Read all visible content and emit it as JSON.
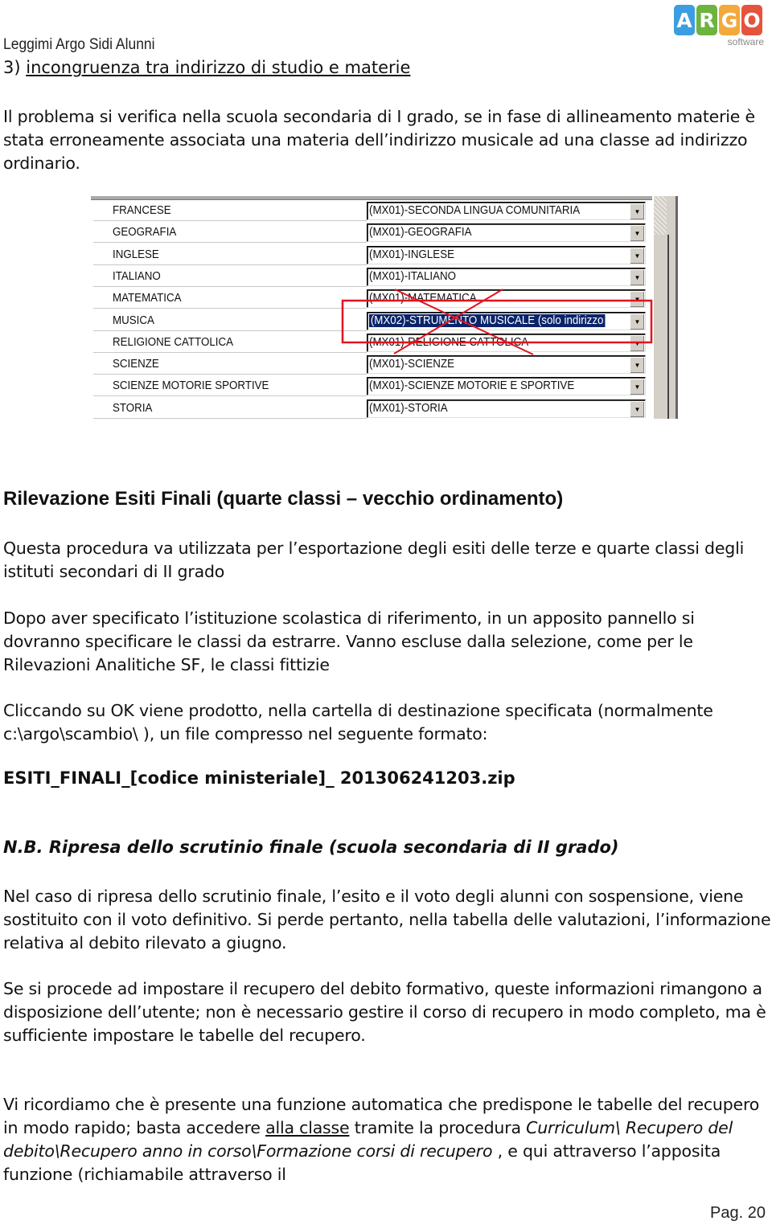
{
  "header": {
    "title": "Leggimi Argo Sidi Alunni",
    "logo": {
      "letters": [
        {
          "char": "A",
          "color": "#3b9ee0"
        },
        {
          "char": "R",
          "color": "#6db33f"
        },
        {
          "char": "G",
          "color": "#f3a93c"
        },
        {
          "char": "O",
          "color": "#e5533d"
        }
      ],
      "subtitle": "software"
    }
  },
  "section3": {
    "number": "3) ",
    "title": "incongruenza tra indirizzo di studio e materie",
    "paragraph": "Il problema si verifica nella scuola secondaria di I grado, se in fase di allineamento materie è stata erroneamente associata una materia dell’indirizzo musicale ad una classe ad indirizzo ordinario."
  },
  "screenshot": {
    "rows": [
      {
        "subject": "FRANCESE",
        "mapping": "(MX01)-SECONDA LINGUA COMUNITARIA",
        "selected": false
      },
      {
        "subject": "GEOGRAFIA",
        "mapping": "(MX01)-GEOGRAFIA",
        "selected": false
      },
      {
        "subject": "INGLESE",
        "mapping": "(MX01)-INGLESE",
        "selected": false
      },
      {
        "subject": "ITALIANO",
        "mapping": "(MX01)-ITALIANO",
        "selected": false
      },
      {
        "subject": "MATEMATICA",
        "mapping": "(MX01)-MATEMATICA",
        "selected": false
      },
      {
        "subject": "MUSICA",
        "mapping": "(MX02)-STRUMENTO MUSICALE (solo indirizzo",
        "selected": true
      },
      {
        "subject": "RELIGIONE CATTOLICA",
        "mapping": "(MX01)-RELIGIONE CATTOLICA",
        "selected": false
      },
      {
        "subject": "SCIENZE",
        "mapping": "(MX01)-SCIENZE",
        "selected": false
      },
      {
        "subject": "SCIENZE MOTORIE SPORTIVE",
        "mapping": "(MX01)-SCIENZE MOTORIE E SPORTIVE",
        "selected": false
      },
      {
        "subject": "STORIA",
        "mapping": "(MX01)-STORIA",
        "selected": false
      }
    ],
    "annotation_color": "#e0141e",
    "dropdown_arrow": "▼"
  },
  "esiti": {
    "heading": "Rilevazione Esiti Finali (quarte classi – vecchio ordinamento)",
    "p1": "Questa procedura va utilizzata per l’esportazione degli esiti delle terze e quarte classi degli istituti secondari di II grado",
    "p2": "Dopo aver specificato l’istituzione scolastica di riferimento, in un apposito pannello si dovranno specificare le classi da estrarre. Vanno escluse dalla selezione, come per le Rilevazioni Analitiche SF, le classi fittizie",
    "p3": "Cliccando su OK viene prodotto, nella cartella di destinazione specificata (normalmente c:\\argo\\scambio\\ ), un file compresso nel seguente formato:",
    "filename": "ESITI_FINALI_[codice ministeriale]_ 201306241203.zip"
  },
  "nb": {
    "heading": "N.B. Ripresa dello scrutinio finale (scuola secondaria di II grado)",
    "p1": "Nel caso di ripresa dello scrutinio finale, l’esito e il voto degli alunni con sospensione, viene sostituito con il voto definitivo. Si perde pertanto, nella tabella delle valutazioni, l’informazione relativa al debito rilevato a giugno.",
    "p2": "Se si procede ad impostare il recupero del debito formativo, queste informazioni rimangono a disposizione dell’utente; non è necessario gestire il corso di recupero in modo completo, ma è sufficiente impostare le tabelle del recupero.",
    "p3_start": "Vi ricordiamo che è presente una funzione automatica che predispone le tabelle del recupero in modo rapido; basta accedere ",
    "p3_link": "alla classe",
    "p3_mid": " tramite la procedura ",
    "p3_path": "Curriculum\\ Recupero del debito\\Recupero anno in corso\\Formazione corsi di recupero",
    "p3_end": " , e qui attraverso l’apposita funzione (richiamabile attraverso il"
  },
  "footer": {
    "page": "Pag. 20"
  }
}
